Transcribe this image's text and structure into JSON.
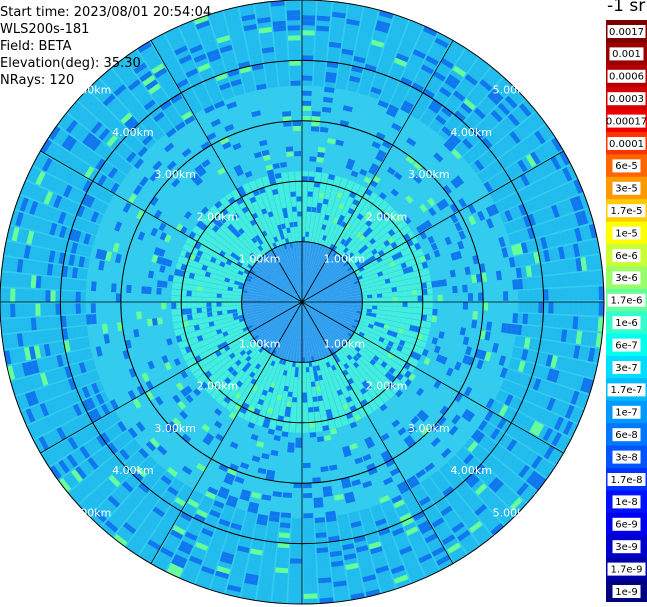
{
  "info": {
    "start_time": "Start time: 2023/08/01 20:54:04",
    "device": "WLS200s-181",
    "field": "Field: BETA",
    "elevation": "Elevation(deg): 35.30",
    "nrays": "NRays: 120"
  },
  "colorbar": {
    "unit": "-1 sr",
    "levels": [
      {
        "label": "0.0017",
        "color": "#7f0000"
      },
      {
        "label": "0.001",
        "color": "#9a0000"
      },
      {
        "label": "0.0006",
        "color": "#b40000"
      },
      {
        "label": "0.0003",
        "color": "#d40000"
      },
      {
        "label": "0.00017",
        "color": "#ee0000"
      },
      {
        "label": "0.0001",
        "color": "#ff3300"
      },
      {
        "label": "6e-5",
        "color": "#ff6600"
      },
      {
        "label": "3e-5",
        "color": "#ff9900"
      },
      {
        "label": "1.7e-5",
        "color": "#ffcc00"
      },
      {
        "label": "1e-5",
        "color": "#ffff00"
      },
      {
        "label": "6e-6",
        "color": "#ccff33"
      },
      {
        "label": "3e-6",
        "color": "#99ff66"
      },
      {
        "label": "1.7e-6",
        "color": "#66ff99"
      },
      {
        "label": "1e-6",
        "color": "#33ffcc"
      },
      {
        "label": "6e-7",
        "color": "#00ffee"
      },
      {
        "label": "3e-7",
        "color": "#00ddff"
      },
      {
        "label": "1.7e-7",
        "color": "#00bbff"
      },
      {
        "label": "1e-7",
        "color": "#0099ff"
      },
      {
        "label": "6e-8",
        "color": "#0077ff"
      },
      {
        "label": "3e-8",
        "color": "#0055ff"
      },
      {
        "label": "1.7e-8",
        "color": "#0033ff"
      },
      {
        "label": "1e-8",
        "color": "#0011ff"
      },
      {
        "label": "6e-9",
        "color": "#0000ee"
      },
      {
        "label": "3e-9",
        "color": "#0000cc"
      },
      {
        "label": "1.7e-9",
        "color": "#0000aa"
      },
      {
        "label": "1e-9",
        "color": "#000080"
      }
    ]
  },
  "chart_data": {
    "type": "ppi",
    "field": "BETA",
    "nrays": 120,
    "range_rings_km": [
      1,
      2,
      3,
      4,
      5
    ],
    "ring_labels": [
      "1.00km",
      "2.00km",
      "3.00km",
      "4.00km",
      "5.00km"
    ],
    "max_range_km": 5,
    "radial_spoke_step_deg": 30,
    "palette": {
      "core": "#3399ee",
      "inner": "#44eedd",
      "mid": "#33ccee",
      "outer": "#22bbee",
      "streak": "#1177ee",
      "speck": "#66ff99",
      "ray_gap": "#ffffff"
    }
  }
}
